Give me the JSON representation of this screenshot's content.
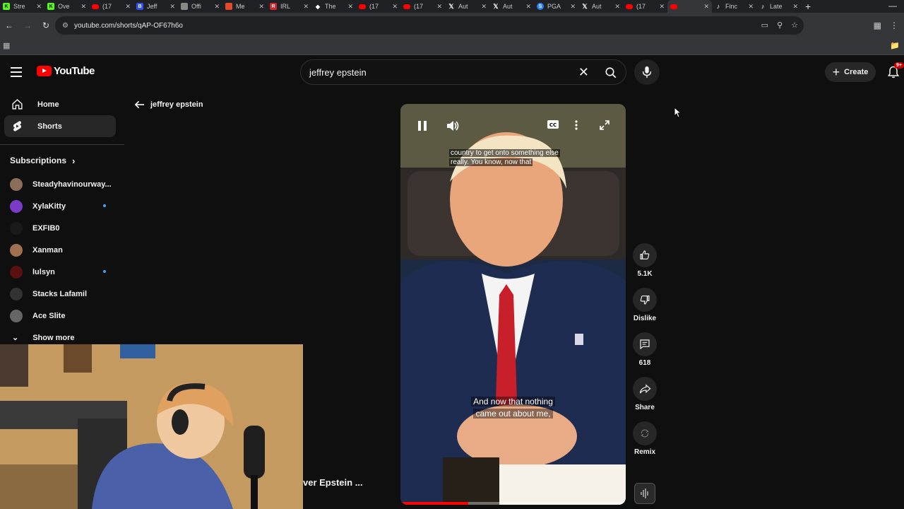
{
  "browser": {
    "tabs": [
      {
        "title": "Stre",
        "favicon": "green-k",
        "color": "#53fc18",
        "active": false
      },
      {
        "title": "Ove",
        "favicon": "green-k",
        "color": "#53fc18",
        "active": false
      },
      {
        "title": "(17",
        "favicon": "youtube",
        "color": "#ff0000",
        "active": false
      },
      {
        "title": "Jeff",
        "favicon": "blue-b",
        "color": "#3050f0",
        "active": false
      },
      {
        "title": "Offi",
        "favicon": "globe",
        "color": "#888888",
        "active": false
      },
      {
        "title": "Me",
        "favicon": "multi",
        "color": "#e24a2b",
        "active": false
      },
      {
        "title": "IRL",
        "favicon": "red-r",
        "color": "#d0262b",
        "active": false
      },
      {
        "title": "The",
        "favicon": "diamond",
        "color": "#ffffff",
        "active": false
      },
      {
        "title": "(17",
        "favicon": "youtube",
        "color": "#ff0000",
        "active": false
      },
      {
        "title": "(17",
        "favicon": "youtube",
        "color": "#ff0000",
        "active": false
      },
      {
        "title": "Aut",
        "favicon": "x",
        "color": "#ffffff",
        "active": false
      },
      {
        "title": "Aut",
        "favicon": "x",
        "color": "#ffffff",
        "active": false
      },
      {
        "title": "PGA",
        "favicon": "blue-s",
        "color": "#2d7ff9",
        "active": false
      },
      {
        "title": "Aut",
        "favicon": "x",
        "color": "#ffffff",
        "active": false
      },
      {
        "title": "(17",
        "favicon": "youtube",
        "color": "#ff0000",
        "active": false
      },
      {
        "title": "",
        "favicon": "youtube",
        "color": "#ff0000",
        "active": true
      },
      {
        "title": "Finc",
        "favicon": "tiktok",
        "color": "#ffffff",
        "active": false
      },
      {
        "title": "Late",
        "favicon": "tiktok",
        "color": "#ffffff",
        "active": false
      }
    ],
    "url": "youtube.com/shorts/qAP-OF67h6o"
  },
  "youtube": {
    "logo_text": "YouTube",
    "search": {
      "value": "jeffrey epstein"
    },
    "create_label": "Create",
    "notification_badge": "9+",
    "sidebar": {
      "home_label": "Home",
      "shorts_label": "Shorts",
      "subscriptions_label": "Subscriptions",
      "show_more_label": "Show more",
      "subscriptions": [
        {
          "name": "Steadyhavinourway...",
          "color": "#8a6e5a",
          "new": false
        },
        {
          "name": "XylaKitty",
          "color": "#7a3cc8",
          "new": true
        },
        {
          "name": "EXFIB0",
          "color": "#1a1a1a",
          "new": false
        },
        {
          "name": "Xanman",
          "color": "#a07050",
          "new": false
        },
        {
          "name": "lulsyn",
          "color": "#5a1010",
          "new": true
        },
        {
          "name": "Stacks Lafamil",
          "color": "#333333",
          "new": false
        },
        {
          "name": "Ace Slite",
          "color": "#666666",
          "new": false
        }
      ]
    },
    "back_query": "jeffrey epstein",
    "player": {
      "caption_top_line1": "country to get onto something else",
      "caption_top_line2": "really. You know, now that",
      "caption_bottom_line1": "And now that nothing",
      "caption_bottom_line2": "came out about me,",
      "progress": 0.3
    },
    "actions": {
      "like_count": "5.1K",
      "dislike_label": "Dislike",
      "comment_count": "618",
      "share_label": "Share",
      "remix_label": "Remix"
    },
    "overlay_title": "ver Epstein ..."
  }
}
